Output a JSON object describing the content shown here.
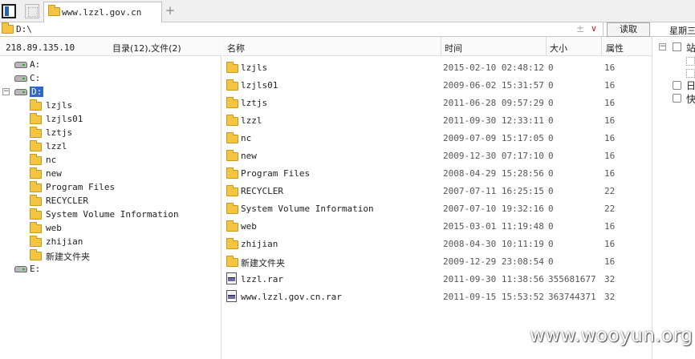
{
  "tab": {
    "title": "www.lzzl.gov.cn",
    "add_label": "+"
  },
  "address": {
    "path": "D:\\",
    "pm_glyph": "±",
    "drop_glyph": "∨",
    "read_button": "读取",
    "weekday": "星期三"
  },
  "left": {
    "ip": "218.89.135.10",
    "count": "目录(12),文件(2)",
    "drives": [
      {
        "label": "A:"
      },
      {
        "label": "C:"
      },
      {
        "label": "D:"
      },
      {
        "label": "E:"
      }
    ],
    "subfolders": [
      "lzjls",
      "lzjls01",
      "lztjs",
      "lzzl",
      "nc",
      "new",
      "Program Files",
      "RECYCLER",
      "System Volume Information",
      "web",
      "zhijian",
      "新建文件夹"
    ]
  },
  "columns": {
    "name": "名称",
    "time": "时间",
    "size": "大小",
    "attr": "属性"
  },
  "files": [
    {
      "name": "lzjls",
      "time": "2015-02-10 02:48:12",
      "size": "0",
      "attr": "16",
      "type": "folder"
    },
    {
      "name": "lzjls01",
      "time": "2009-06-02 15:31:57",
      "size": "0",
      "attr": "16",
      "type": "folder"
    },
    {
      "name": "lztjs",
      "time": "2011-06-28 09:57:29",
      "size": "0",
      "attr": "16",
      "type": "folder"
    },
    {
      "name": "lzzl",
      "time": "2011-09-30 12:33:11",
      "size": "0",
      "attr": "16",
      "type": "folder"
    },
    {
      "name": "nc",
      "time": "2009-07-09 15:17:05",
      "size": "0",
      "attr": "16",
      "type": "folder"
    },
    {
      "name": "new",
      "time": "2009-12-30 07:17:10",
      "size": "0",
      "attr": "16",
      "type": "folder"
    },
    {
      "name": "Program Files",
      "time": "2008-04-29 15:28:56",
      "size": "0",
      "attr": "16",
      "type": "folder"
    },
    {
      "name": "RECYCLER",
      "time": "2007-07-11 16:25:15",
      "size": "0",
      "attr": "22",
      "type": "folder"
    },
    {
      "name": "System Volume Information",
      "time": "2007-07-10 19:32:16",
      "size": "0",
      "attr": "22",
      "type": "folder"
    },
    {
      "name": "web",
      "time": "2015-03-01 11:19:48",
      "size": "0",
      "attr": "16",
      "type": "folder"
    },
    {
      "name": "zhijian",
      "time": "2008-04-30 10:11:19",
      "size": "0",
      "attr": "16",
      "type": "folder"
    },
    {
      "name": "新建文件夹",
      "time": "2009-12-29 23:08:54",
      "size": "0",
      "attr": "16",
      "type": "folder"
    },
    {
      "name": "lzzl.rar",
      "time": "2011-09-30 11:38:56",
      "size": "355681677",
      "attr": "32",
      "type": "rar"
    },
    {
      "name": "www.lzzl.gov.cn.rar",
      "time": "2011-09-15 15:53:52",
      "size": "363744371",
      "attr": "32",
      "type": "rar"
    }
  ],
  "sidebar": {
    "items": [
      "站",
      "日",
      "快"
    ]
  },
  "watermark": "www.wooyun.org",
  "colors": {
    "selection": "#3168c8",
    "folder": "#f4c542"
  }
}
